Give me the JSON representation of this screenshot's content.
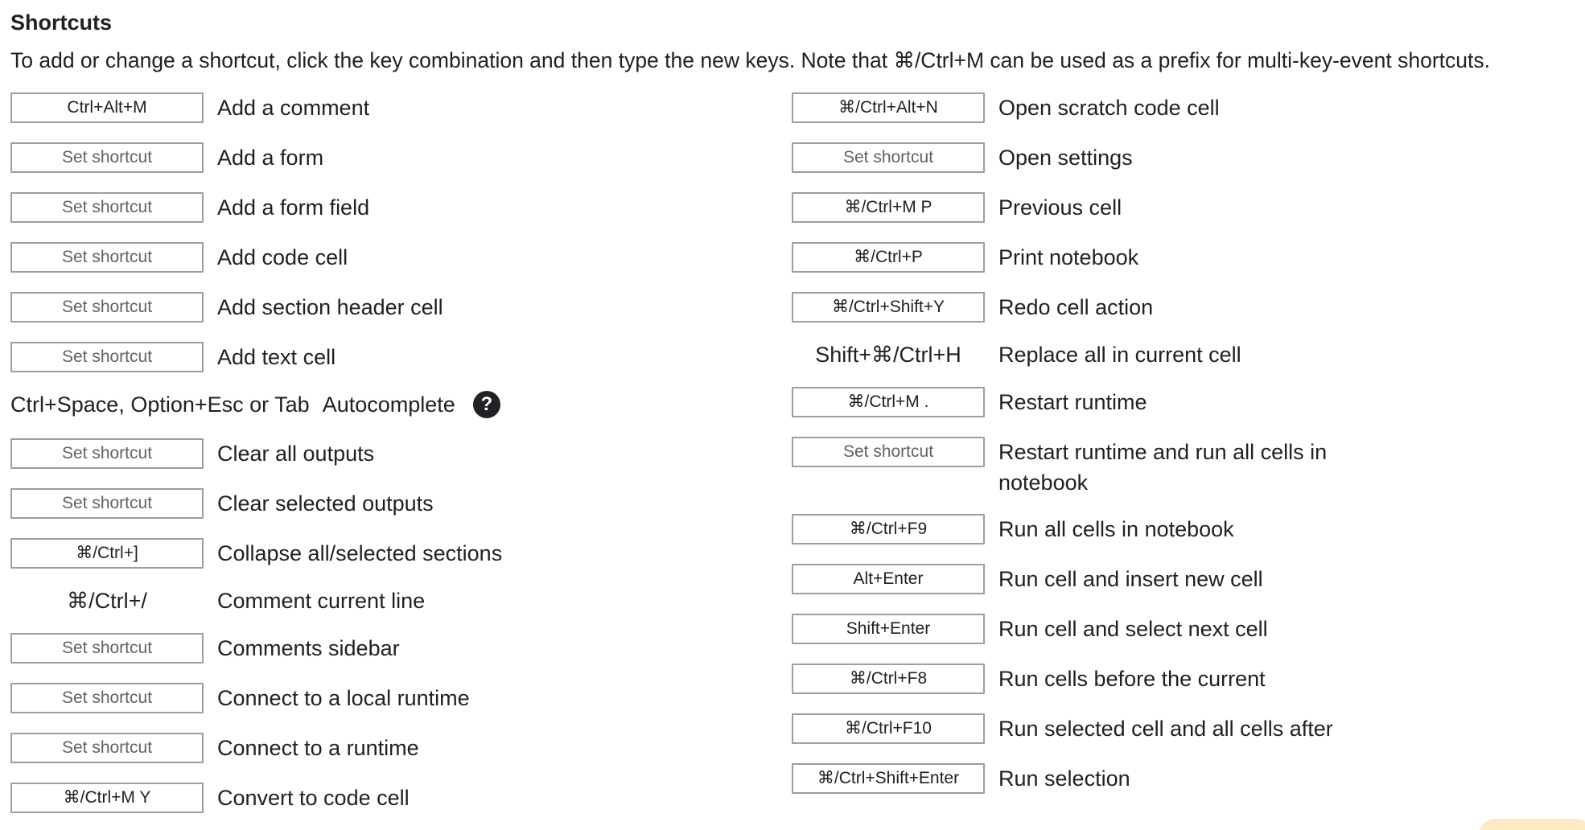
{
  "header": {
    "title": "Shortcuts",
    "description": "To add or change a shortcut, click the key combination and then type the new keys. Note that ⌘/Ctrl+M can be used as a prefix for multi-key-event shortcuts."
  },
  "left": [
    {
      "key": "Ctrl+Alt+M",
      "label": "Add a comment"
    },
    {
      "key": "Set shortcut",
      "label": "Add a form"
    },
    {
      "key": "Set shortcut",
      "label": "Add a form field"
    },
    {
      "key": "Set shortcut",
      "label": "Add code cell"
    },
    {
      "key": "Set shortcut",
      "label": "Add section header cell"
    },
    {
      "key": "Set shortcut",
      "label": "Add text cell"
    },
    {
      "key": "Set shortcut",
      "label": "Clear all outputs"
    },
    {
      "key": "Set shortcut",
      "label": "Clear selected outputs"
    },
    {
      "key": "⌘/Ctrl+]",
      "label": "Collapse all/selected sections"
    },
    {
      "key": "⌘/Ctrl+/",
      "label": "Comment current line"
    },
    {
      "key": "Set shortcut",
      "label": "Comments sidebar"
    },
    {
      "key": "Set shortcut",
      "label": "Connect to a local runtime"
    },
    {
      "key": "Set shortcut",
      "label": "Connect to a runtime"
    },
    {
      "key": "⌘/Ctrl+M Y",
      "label": "Convert to code cell"
    }
  ],
  "autocomplete": {
    "keys": "Ctrl+Space, Option+Esc or Tab",
    "label": "Autocomplete",
    "help_glyph": "?",
    "help_icon": "help-circle-icon"
  },
  "right": [
    {
      "key": "⌘/Ctrl+Alt+N",
      "label": "Open scratch code cell"
    },
    {
      "key": "Set shortcut",
      "label": "Open settings"
    },
    {
      "key": "⌘/Ctrl+M P",
      "label": "Previous cell"
    },
    {
      "key": "⌘/Ctrl+P",
      "label": "Print notebook"
    },
    {
      "key": "⌘/Ctrl+Shift+Y",
      "label": "Redo cell action"
    },
    {
      "key": "Shift+⌘/Ctrl+H",
      "label": "Replace all in current cell"
    },
    {
      "key": "⌘/Ctrl+M .",
      "label": "Restart runtime"
    },
    {
      "key": "Set shortcut",
      "label": "Restart runtime and run all cells in notebook"
    },
    {
      "key": "⌘/Ctrl+F9",
      "label": "Run all cells in notebook"
    },
    {
      "key": "Alt+Enter",
      "label": "Run cell and insert new cell"
    },
    {
      "key": "Shift+Enter",
      "label": "Run cell and select next cell"
    },
    {
      "key": "⌘/Ctrl+F8",
      "label": "Run cells before the current"
    },
    {
      "key": "⌘/Ctrl+F10",
      "label": "Run selected cell and all cells after"
    },
    {
      "key": "⌘/Ctrl+Shift+Enter",
      "label": "Run selection"
    }
  ],
  "colors": {
    "text": "#202124",
    "key_border": "#9e9e9e",
    "unset_text": "#5f6368"
  }
}
